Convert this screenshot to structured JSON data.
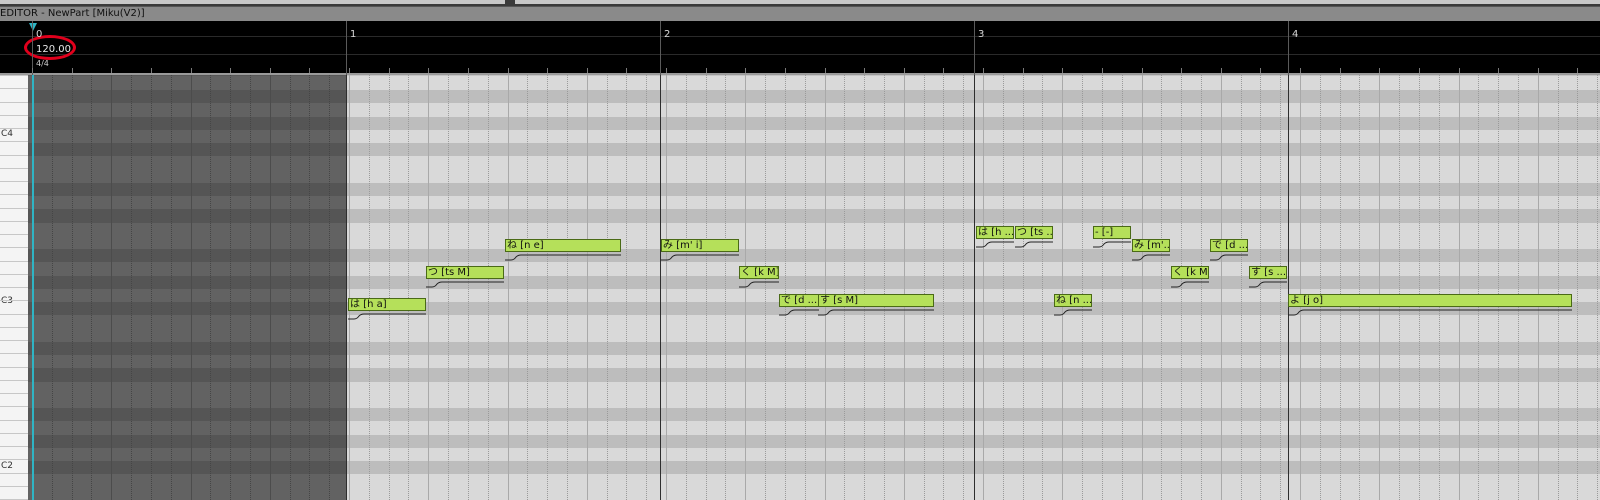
{
  "window": {
    "title": "EDITOR - NewPart [Miku(V2)]"
  },
  "ruler": {
    "tempo": "120.00",
    "time_signature": "4/4",
    "measures": [
      "0",
      "1",
      "2",
      "3",
      "4"
    ]
  },
  "keyboard": {
    "labels": [
      "C4",
      "C3",
      "C2"
    ]
  },
  "notes": [
    {
      "lyric": "は [h a]"
    },
    {
      "lyric": "つ [ts M]"
    },
    {
      "lyric": "ね [n e]"
    },
    {
      "lyric": "み [m' i]"
    },
    {
      "lyric": "く [k M]"
    },
    {
      "lyric": "で [d ..."
    },
    {
      "lyric": "す [s M]"
    },
    {
      "lyric": "は [h ..."
    },
    {
      "lyric": "つ [ts ..."
    },
    {
      "lyric": "ね [n ..."
    },
    {
      "lyric": "- [-]"
    },
    {
      "lyric": "み [m'..."
    },
    {
      "lyric": "く [k M]"
    },
    {
      "lyric": "で [d ..."
    },
    {
      "lyric": "す [s ..."
    },
    {
      "lyric": "よ [j o]"
    }
  ],
  "colors": {
    "note_fill": "#b5e05a",
    "tempo_highlight": "#e0001c",
    "playhead": "#2fb4c4"
  }
}
